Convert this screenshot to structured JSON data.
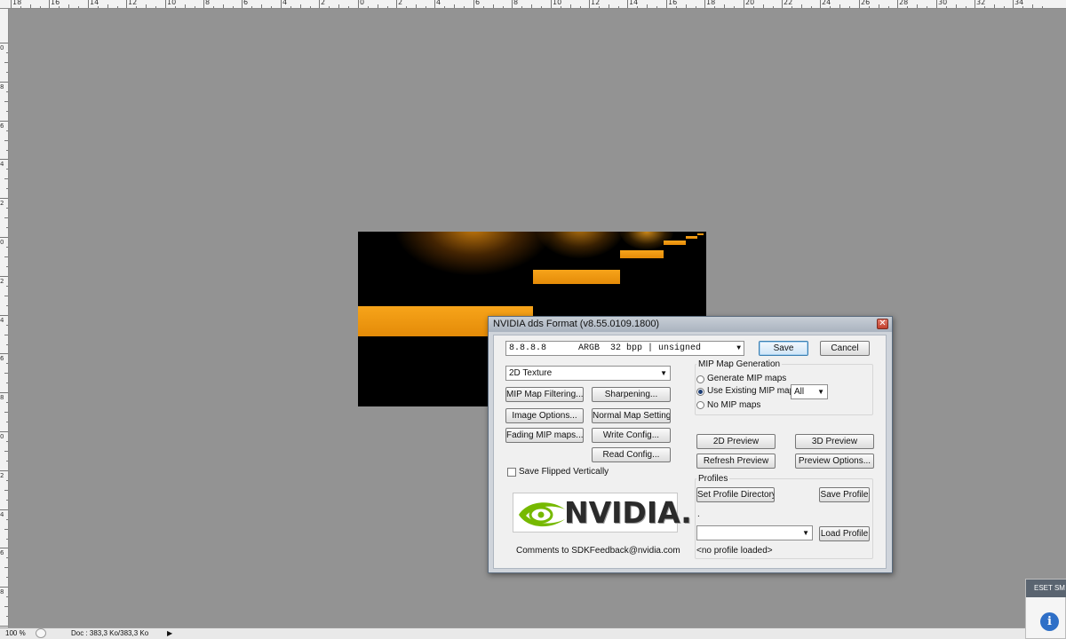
{
  "ruler": {
    "top_labels": [
      "18",
      "16",
      "14",
      "12",
      "10",
      "8",
      "6",
      "4",
      "2",
      "0",
      "2",
      "4",
      "6",
      "8",
      "10",
      "12",
      "14",
      "16",
      "18",
      "20",
      "22",
      "24",
      "26",
      "28",
      "30",
      "32",
      "34"
    ],
    "left_labels": [
      "0",
      "8",
      "6",
      "4",
      "2",
      "0",
      "2",
      "4",
      "6",
      "8",
      "0",
      "2",
      "4",
      "6",
      "8",
      "2"
    ]
  },
  "dialog": {
    "title": "NVIDIA dds Format (v8.55.0109.1800)",
    "close_glyph": "✕",
    "format_select": "8.8.8.8      ARGB  32 bpp | unsigned",
    "save_label": "Save",
    "cancel_label": "Cancel",
    "texture_type": "2D Texture",
    "buttons": {
      "mip_filtering": "MIP Map Filtering...",
      "sharpening": "Sharpening...",
      "image_options": "Image Options...",
      "normal_map": "Normal Map Settings...",
      "fading": "Fading MIP maps...",
      "write_config": "Write Config...",
      "read_config": "Read Config..."
    },
    "save_flipped_label": "Save Flipped Vertically",
    "mip": {
      "group_label": "MIP Map Generation",
      "generate": "Generate MIP maps",
      "use_existing": "Use Existing MIP maps",
      "none": "No MIP maps",
      "count_value": "All"
    },
    "preview": {
      "preview_2d": "2D Preview",
      "preview_3d": "3D Preview",
      "refresh": "Refresh Preview",
      "options": "Preview Options..."
    },
    "profiles": {
      "group_label": "Profiles",
      "set_dir": "Set Profile Directory",
      "save": "Save Profile",
      "dot": ".",
      "load": "Load Profile",
      "status": "<no profile loaded>"
    },
    "logo_text": "NVIDIA.",
    "comments": "Comments to SDKFeedback@nvidia.com"
  },
  "statusbar": {
    "zoom": "100 %",
    "doc": "Doc : 383,3 Ko/383,3 Ko",
    "arrow": "▶"
  },
  "eset": {
    "header": "ESET SM",
    "info_glyph": "i"
  },
  "colors": {
    "workspace": "#939393",
    "amber": "#f7a41a",
    "nvidia_green": "#76b900",
    "accent_button": "#3c7fb1"
  }
}
